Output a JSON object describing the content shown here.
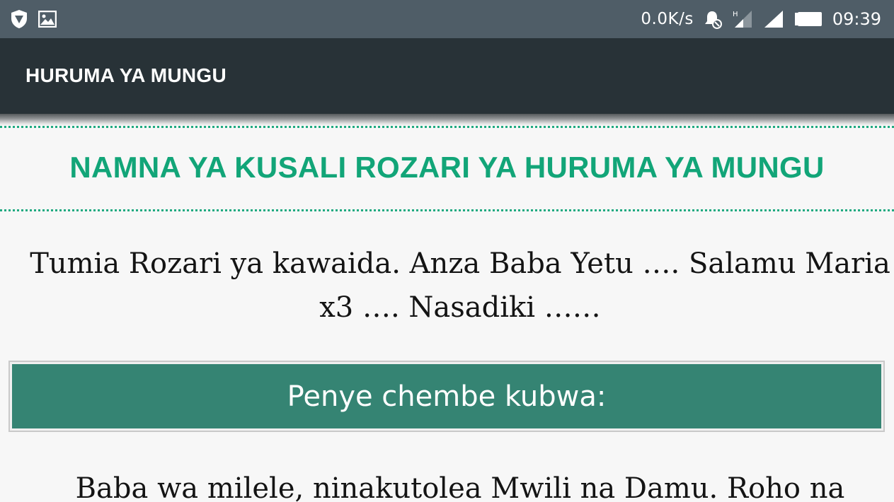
{
  "status_bar": {
    "left_icons": [
      "shield-icon",
      "image-icon"
    ],
    "network_speed": "0.0K/s",
    "right_icons": [
      "alarm-muted-icon",
      "signal-h-icon",
      "signal-icon",
      "battery-icon"
    ],
    "time": "09:39",
    "background": "#4f5d67"
  },
  "toolbar": {
    "title": "HURUMA YA MUNGU",
    "background": "#283237"
  },
  "content": {
    "section_title": "NAMNA YA KUSALI ROZARI YA HURUMA YA MUNGU",
    "intro_text": "Tumia Rozari ya kawaida. Anza Baba Yetu …. Salamu Maria x3 …. Nasadiki ……",
    "large_bead_label": "Penye chembe kubwa:",
    "prayer_text": "Baba wa milele, ninakutolea Mwili na Damu. Roho na",
    "accent_color": "#12a578",
    "bead_box_color": "#358473"
  }
}
